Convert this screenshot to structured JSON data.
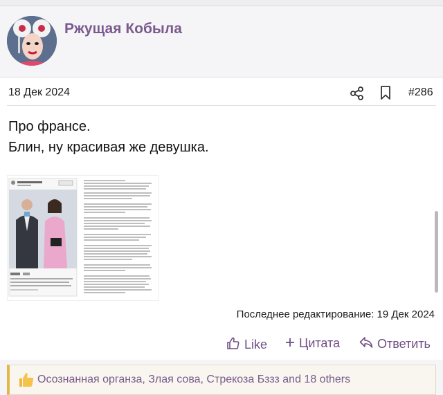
{
  "user": {
    "name": "Ржущая Кобыла"
  },
  "post": {
    "date": "18 Дек 2024",
    "number": "#286",
    "message_lines": [
      "Про франсе.",
      "Блин, ну красивая же девушка."
    ],
    "edited_label": "Последнее редактирование: 19 Дек 2024"
  },
  "actions": {
    "like": "Like",
    "quote": "Цитата",
    "reply": "Ответить"
  },
  "reactions": {
    "text": "Осознанная органза, Злая сова, Стрекоза Бззз and 18 others"
  },
  "colors": {
    "accent": "#7b5a8e",
    "reaction_bar": "#e2b84a"
  }
}
